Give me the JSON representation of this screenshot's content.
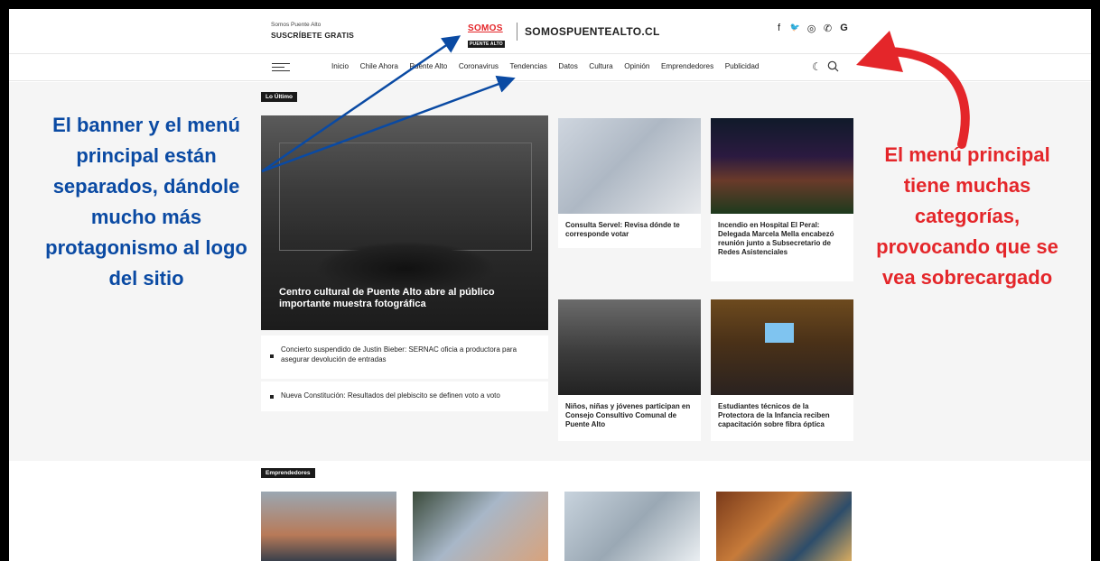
{
  "header": {
    "subscribe_small": "Somos Puente Alto",
    "subscribe_cta": "SUSCRÍBETE GRATIS",
    "logo_top": "SOMOS",
    "logo_bottom": "PUENTE ALTO",
    "site_name": "SOMOSPUENTEALTO.CL",
    "socials": [
      "facebook-icon",
      "twitter-icon",
      "instagram-icon",
      "whatsapp-icon",
      "google-icon"
    ],
    "social_glyphs": [
      "f",
      "🐦",
      "◎",
      "✆",
      "G"
    ]
  },
  "nav": {
    "items": [
      "Inicio",
      "Chile Ahora",
      "Puente Alto",
      "Coronavirus",
      "Tendencias",
      "Datos",
      "Cultura",
      "Opinión",
      "Emprendedores",
      "Publicidad"
    ]
  },
  "sections": {
    "latest_label": "Lo Último",
    "entrepreneurs_label": "Emprendedores"
  },
  "hero": {
    "caption": "Centro cultural de Puente Alto abre al público importante muestra fotográfica"
  },
  "list": [
    "Concierto suspendido de Justin Bieber: SERNAC oficia a productora para asegurar devolución de entradas",
    "Nueva Constitución: Resultados del plebiscito se definen voto a voto"
  ],
  "cards": [
    "Consulta Servel: Revisa dónde te corresponde votar",
    "Incendio en Hospital El Peral: Delegada Marcela Mella encabezó reunión junto a Subsecretario de Redes Asistenciales",
    "Niños, niñas y jóvenes participan en Consejo Consultivo Comunal de Puente Alto",
    "Estudiantes técnicos de la Protectora de la Infancia reciben capacitación sobre fibra óptica"
  ],
  "annotations": {
    "left": "El banner y el menú principal están separados, dándole mucho más protagonismo al logo del sitio",
    "right": "El menú principal tiene muchas categorías, provocando que se vea sobrecargado"
  },
  "colors": {
    "annotation_blue": "#0a4aa3",
    "annotation_red": "#e4262a",
    "brand_red": "#e4262a"
  }
}
